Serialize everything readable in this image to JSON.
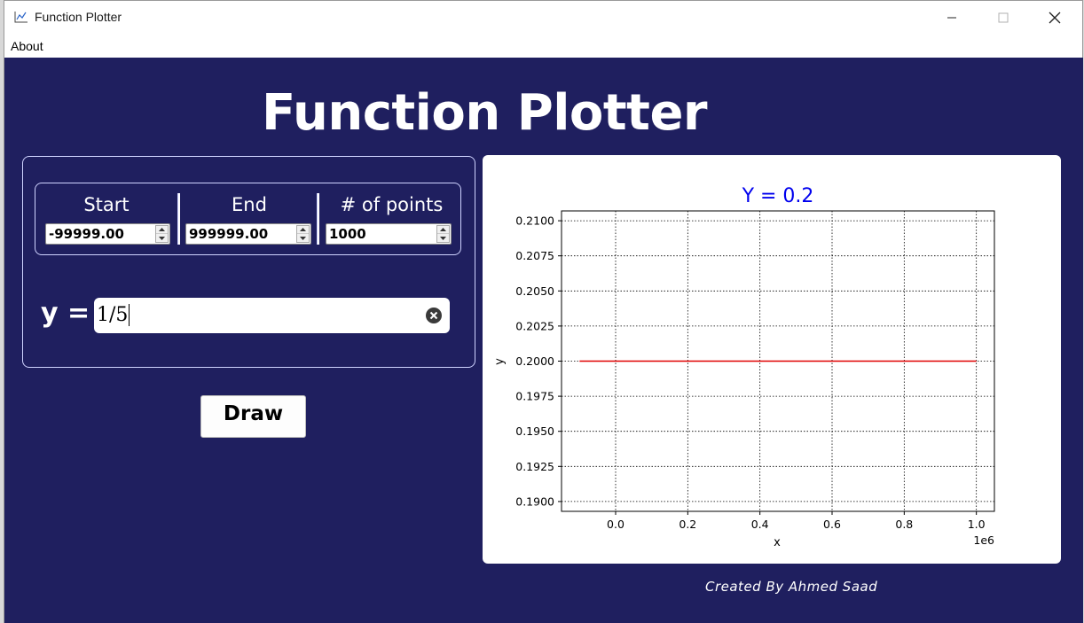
{
  "window": {
    "title": "Function Plotter",
    "icon": "chart-line-icon"
  },
  "menu": {
    "about": "About"
  },
  "app": {
    "heading": "Function Plotter",
    "footer": "Created By Ahmed Saad"
  },
  "range": {
    "start_label": "Start",
    "start_value": "-99999.00",
    "end_label": "End",
    "end_value": "999999.00",
    "points_label": "# of points",
    "points_value": "1000"
  },
  "expression": {
    "label": "y =",
    "value": "1/5"
  },
  "buttons": {
    "draw": "Draw"
  },
  "colors": {
    "background": "#1f1f5f",
    "line": "#e00000",
    "title": "#0000ee"
  },
  "chart_data": {
    "type": "line",
    "title": "Y = 0.2",
    "xlabel": "x",
    "ylabel": "y",
    "x_offset_text": "1e6",
    "xlim": [
      -0.15,
      1.05
    ],
    "ylim": [
      0.1893,
      0.2107
    ],
    "xticks": [
      0.0,
      0.2,
      0.4,
      0.6,
      0.8,
      1.0
    ],
    "xtick_labels": [
      "0.0",
      "0.2",
      "0.4",
      "0.6",
      "0.8",
      "1.0"
    ],
    "yticks": [
      0.19,
      0.1925,
      0.195,
      0.1975,
      0.2,
      0.2025,
      0.205,
      0.2075,
      0.21
    ],
    "ytick_labels": [
      "0.1900",
      "0.1925",
      "0.1950",
      "0.1975",
      "0.2000",
      "0.2025",
      "0.2050",
      "0.2075",
      "0.2100"
    ],
    "grid": true,
    "series": [
      {
        "x": [
          -0.099999,
          0.999999
        ],
        "y": [
          0.2,
          0.2
        ],
        "color": "#e00000"
      }
    ]
  }
}
